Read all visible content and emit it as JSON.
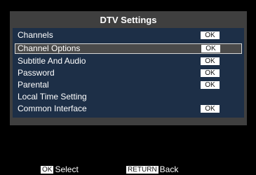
{
  "menu": {
    "title": "DTV Settings",
    "items": [
      {
        "label": "Channels",
        "badge": "OK"
      },
      {
        "label": "Channel Options",
        "badge": "OK"
      },
      {
        "label": "Subtitle And Audio",
        "badge": "OK"
      },
      {
        "label": "Password",
        "badge": "OK"
      },
      {
        "label": "Parental",
        "badge": "OK"
      },
      {
        "label": "Local Time Setting",
        "badge": ""
      },
      {
        "label": "Common Interface",
        "badge": "OK"
      }
    ],
    "selected_index": 1
  },
  "footer": {
    "select_key": "OK",
    "select_label": "Select",
    "back_key": "RETURN",
    "back_label": "Back"
  },
  "colors": {
    "panel": "#3f3f3f",
    "list_background": "#1d2f47",
    "selection": "#4a4a4a",
    "screen": "#000000"
  }
}
